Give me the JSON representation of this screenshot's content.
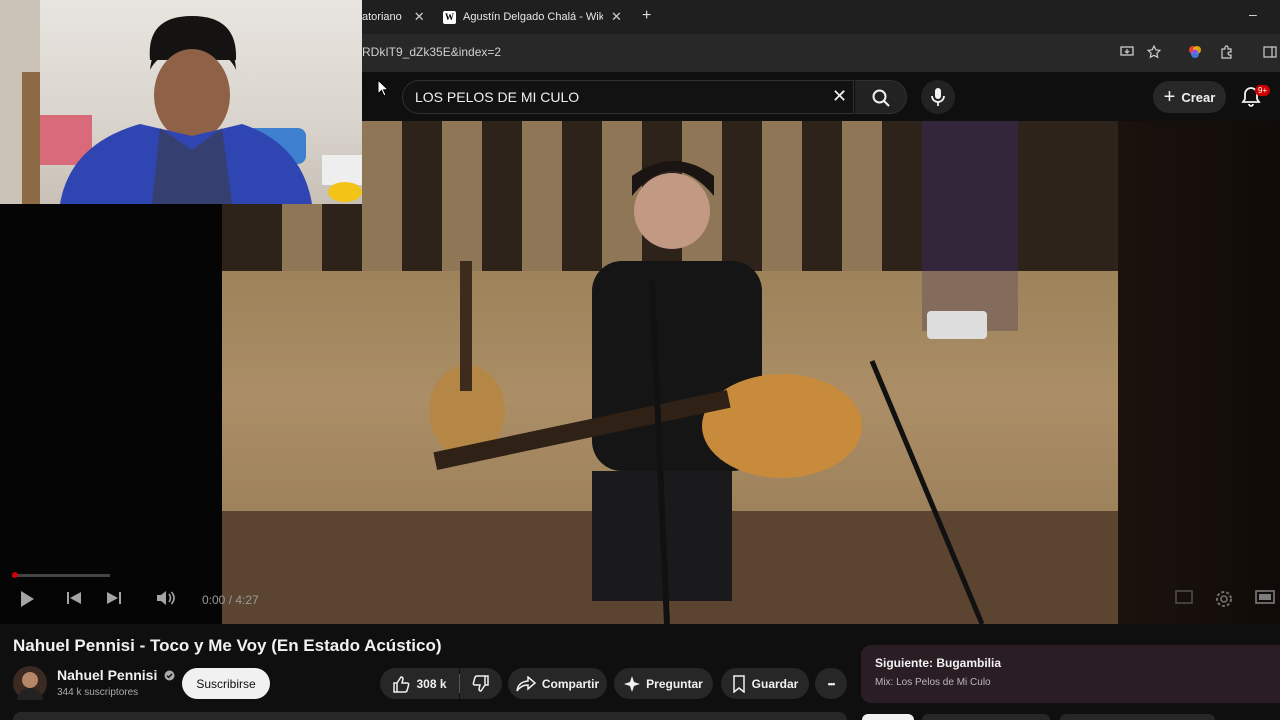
{
  "browser": {
    "tabs": [
      {
        "label": "atoriano",
        "close": "✕"
      },
      {
        "label": "Agustín Delgado Chalá - Wikip",
        "favicon": "W",
        "close": "✕"
      }
    ],
    "new_tab": "+",
    "minimize": "–",
    "url": "RDkIT9_dZk35E&index=2",
    "toolbar_icons": [
      "install-icon",
      "bookmark-star-icon",
      "profile-color-icon",
      "extensions-icon",
      "sidebar-icon"
    ]
  },
  "header": {
    "search_query": "LOS PELOS DE MI CULO",
    "clear": "✕",
    "create_label": "Crear",
    "notifications_badge": "9+"
  },
  "player": {
    "time": "0:00 / 4:27",
    "progress_fraction": 0.0,
    "controls": [
      "play-icon",
      "previous-icon",
      "next-icon",
      "volume-icon"
    ],
    "right_controls": [
      "miniplayer-icon",
      "settings-icon",
      "theater-icon"
    ]
  },
  "video": {
    "title": "Nahuel Pennisi - Toco y Me Voy (En Estado Acústico)",
    "channel": "Nahuel Pennisi",
    "subscribers": "344 k suscriptores",
    "subscribe_label": "Suscribirse",
    "likes": "308 k",
    "share_label": "Compartir",
    "ask_label": "Preguntar",
    "save_label": "Guardar",
    "more": "•••"
  },
  "up_next": {
    "title": "Siguiente: Bugambilia",
    "subtitle": "Mix: Los Pelos de Mi Culo"
  },
  "colors": {
    "background": "#0f0f0f",
    "accent_red": "#cc0000",
    "up_next_bg": "#2b1d24"
  }
}
